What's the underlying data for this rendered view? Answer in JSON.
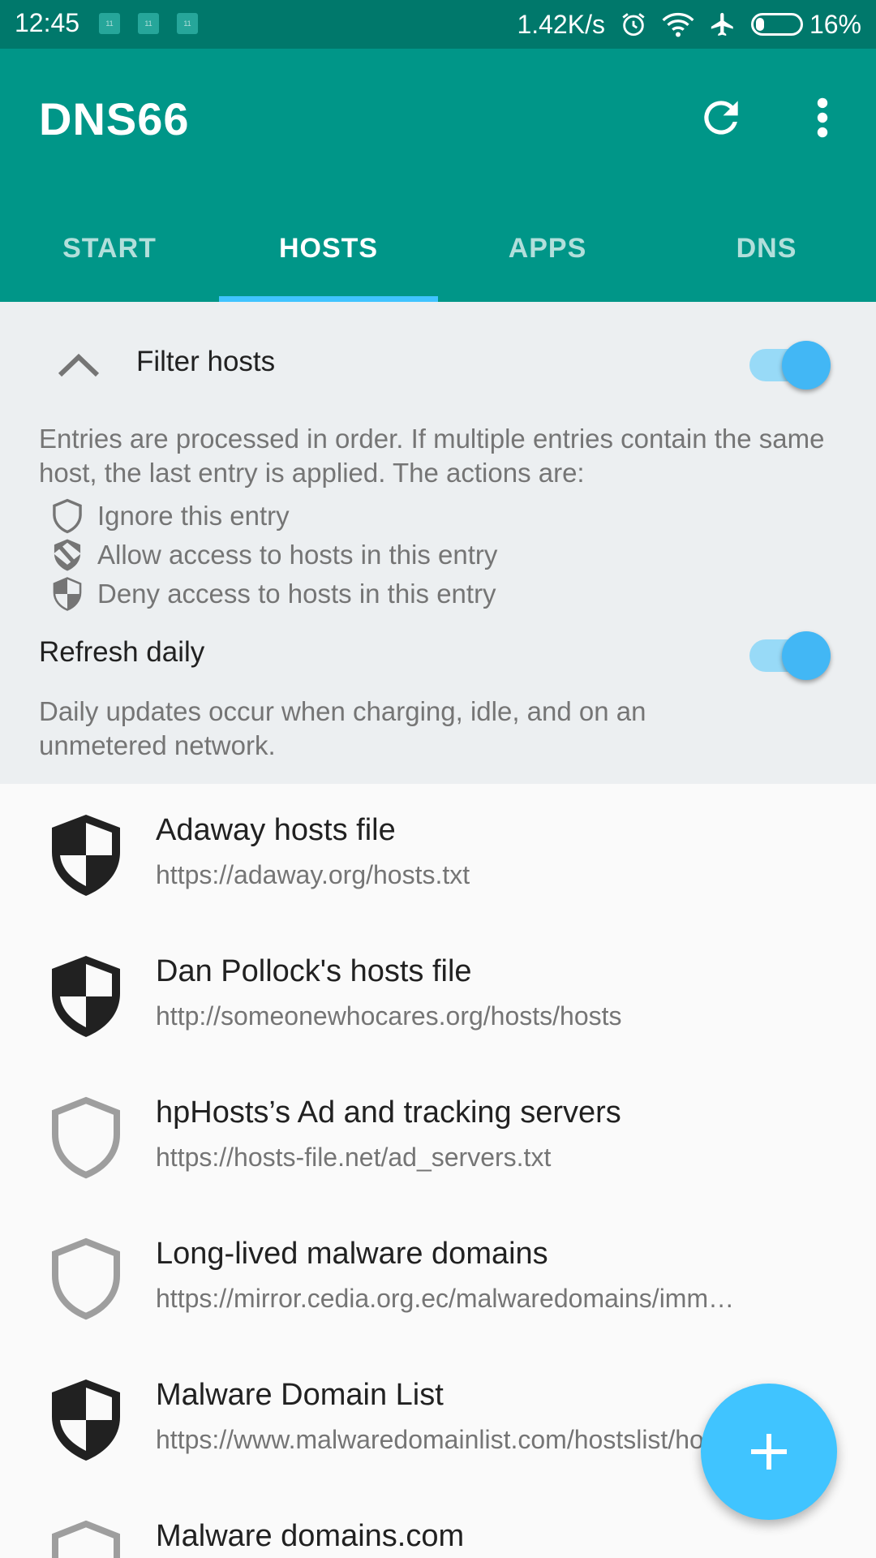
{
  "status_bar": {
    "time": "12:45",
    "notif_label": "11",
    "net_speed": "1.42K/s",
    "battery": "16%",
    "icons": [
      "alarm-icon",
      "wifi-icon",
      "airplane-icon",
      "battery-icon"
    ]
  },
  "app_bar": {
    "title": "DNS66",
    "actions": [
      "refresh-icon",
      "more-vert-icon"
    ]
  },
  "tabs": [
    {
      "label": "START",
      "active": false
    },
    {
      "label": "HOSTS",
      "active": true
    },
    {
      "label": "APPS",
      "active": false
    },
    {
      "label": "DNS",
      "active": false
    }
  ],
  "filter": {
    "label": "Filter hosts",
    "enabled": true,
    "description": "Entries are processed in order. If multiple entries contain the same host, the last entry is applied. The actions are:",
    "actions": [
      {
        "icon": "shield-outline-icon",
        "label": "Ignore this entry"
      },
      {
        "icon": "shield-allow-icon",
        "label": "Allow access to hosts in this entry"
      },
      {
        "icon": "shield-deny-icon",
        "label": "Deny access to hosts in this entry"
      }
    ],
    "refresh_label": "Refresh daily",
    "refresh_enabled": true,
    "refresh_description": "Daily updates occur when charging, idle, and on an unmetered network."
  },
  "hosts": [
    {
      "title": "Adaway hosts file",
      "url": "https://adaway.org/hosts.txt",
      "action": "deny"
    },
    {
      "title": "Dan Pollock's hosts file",
      "url": "http://someonewhocares.org/hosts/hosts",
      "action": "deny"
    },
    {
      "title": "hpHosts’s Ad and tracking servers",
      "url": "https://hosts-file.net/ad_servers.txt",
      "action": "ignore"
    },
    {
      "title": "Long-lived malware domains",
      "url": "https://mirror.cedia.org.ec/malwaredomains/imm…",
      "action": "ignore"
    },
    {
      "title": "Malware Domain List",
      "url": "https://www.malwaredomainlist.com/hostslist/hosts.txt",
      "action": "deny"
    },
    {
      "title": "Malware domains.com",
      "url": "",
      "action": "ignore"
    }
  ],
  "fab": {
    "icon": "add-icon"
  },
  "colors": {
    "primary": "#009688",
    "primary_dark": "#00786b",
    "accent": "#40c4ff"
  }
}
